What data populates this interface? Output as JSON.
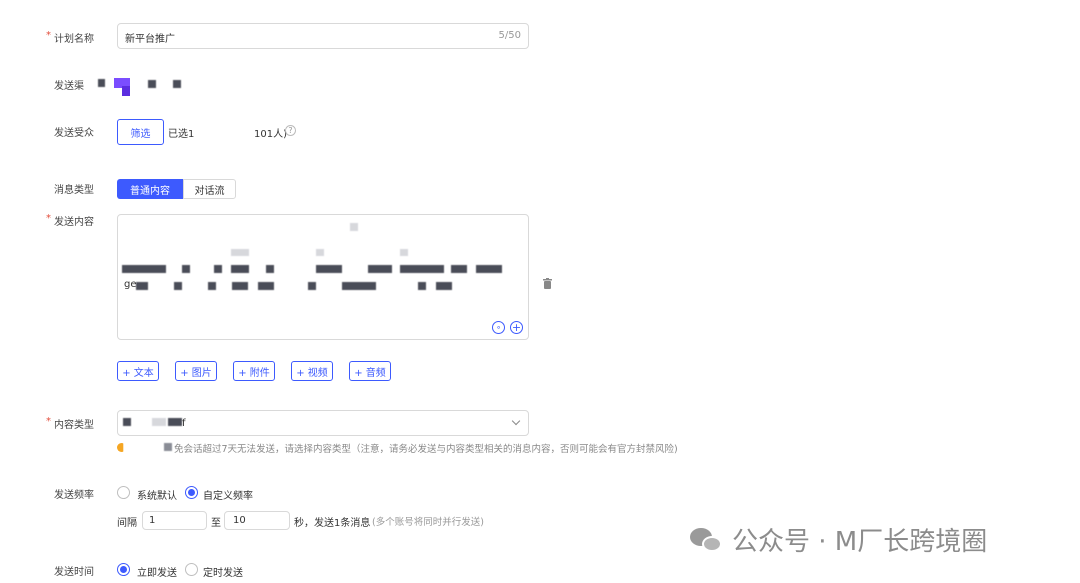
{
  "form": {
    "plan_name": {
      "label": "计划名称",
      "value": "新平台推广",
      "counter": "5/50"
    },
    "channel": {
      "label": "发送渠"
    },
    "audience": {
      "label": "发送受众",
      "filter_btn": "筛选",
      "selected_prefix": "已选1",
      "selected_suffix": "101人)"
    },
    "msg_type": {
      "label": "消息类型",
      "options": [
        "普通内容",
        "对话流"
      ]
    },
    "content": {
      "label": "发送内容",
      "line2_prefix": "ge"
    },
    "add_buttons": [
      "+ 文本",
      "+ 图片",
      "+ 附件",
      "+ 视频",
      "+ 音频"
    ],
    "content_type": {
      "label": "内容类型",
      "value_suffix": "f",
      "hint": "免会话超过7天无法发送，请选择内容类型（注意，请务必发送与内容类型相关的消息内容，否则可能会有官方封禁风险)"
    },
    "frequency": {
      "label": "发送频率",
      "options": [
        "系统默认",
        "自定义频率"
      ],
      "interval_label": "间隔",
      "from": "1",
      "to_label": "至",
      "to": "10",
      "suffix": "秒，发送1条消息",
      "note": "(多个账号将同时并行发送)"
    },
    "send_time": {
      "label": "发送时间",
      "options": [
        "立即发送",
        "定时发送"
      ]
    }
  },
  "watermark": {
    "text": "公众号 · M厂长跨境圈"
  },
  "colors": {
    "accent": "#3d5afe",
    "required": "#e34d3c",
    "channel_icon": "#7b4dff"
  }
}
